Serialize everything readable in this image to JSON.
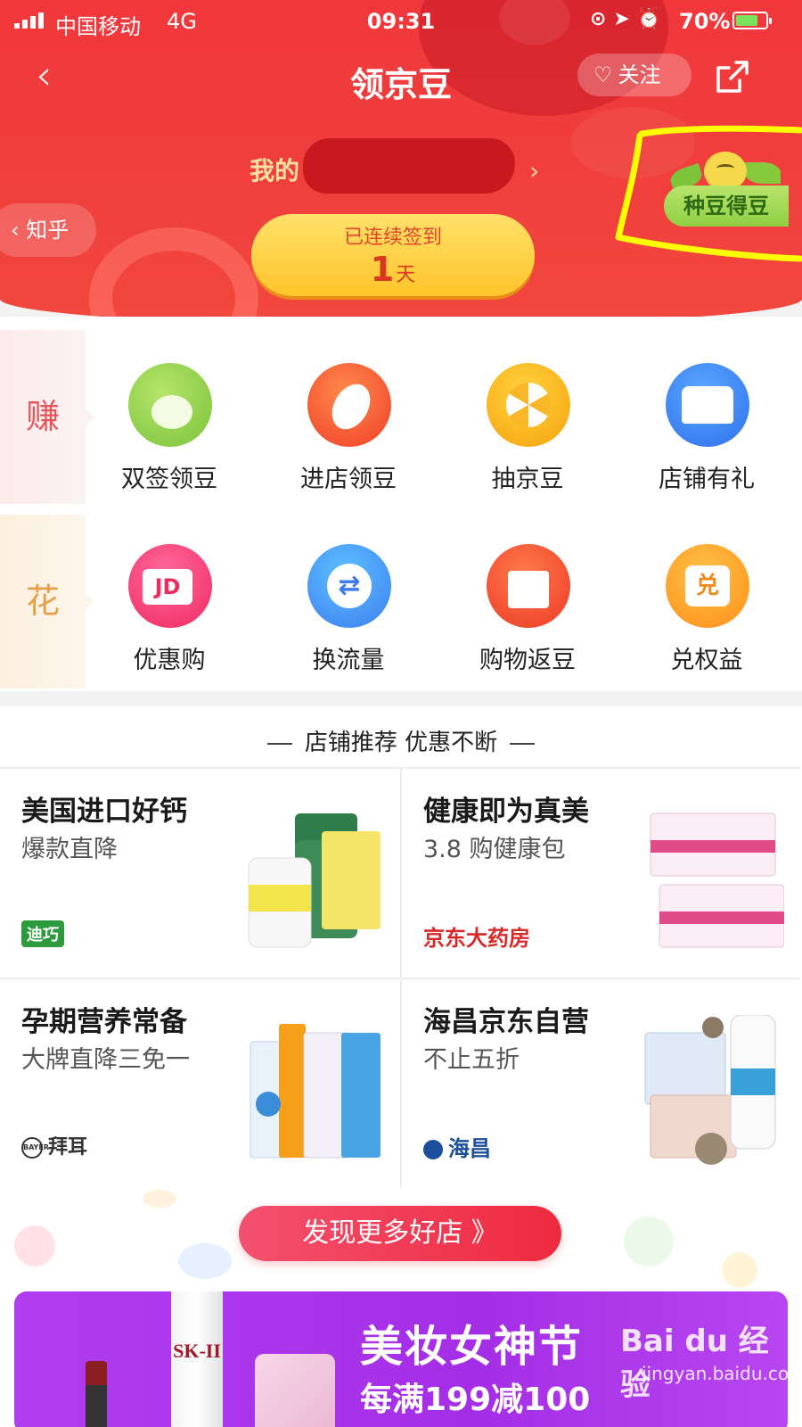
{
  "status_bar": {
    "carrier": "中国移动",
    "network": "4G",
    "time": "09:31",
    "battery": "70%"
  },
  "nav": {
    "title": "领京豆",
    "follow_label": "关注"
  },
  "header": {
    "my_beans_label": "我的",
    "zhihu_back_label": "知乎",
    "signin_label": "已连续签到",
    "signin_days": "1",
    "signin_unit": "天",
    "plant_badge": "种豆得豆"
  },
  "categories": {
    "earn_label": "赚",
    "spend_label": "花"
  },
  "earn_items": [
    {
      "label": "双签领豆",
      "icon": "bean-green-icon"
    },
    {
      "label": "进店领豆",
      "icon": "bean-orange-icon"
    },
    {
      "label": "抽京豆",
      "icon": "lottery-wheel-icon"
    },
    {
      "label": "店铺有礼",
      "icon": "store-icon"
    }
  ],
  "spend_items": [
    {
      "label": "优惠购",
      "icon": "jd-cart-icon"
    },
    {
      "label": "换流量",
      "icon": "exchange-arrows-icon"
    },
    {
      "label": "购物返豆",
      "icon": "gift-box-icon"
    },
    {
      "label": "兑权益",
      "icon": "redeem-icon"
    }
  ],
  "recommend": {
    "title": "店铺推荐 优惠不断",
    "cards": [
      {
        "title": "美国进口好钙",
        "subtitle": "爆款直降",
        "brand": "迪巧"
      },
      {
        "title": "健康即为真美",
        "subtitle": "3.8 购健康包",
        "brand": "京东大药房"
      },
      {
        "title": "孕期营养常备",
        "subtitle": "大牌直降三免一",
        "brand": "拜耳"
      },
      {
        "title": "海昌京东自营",
        "subtitle": "不止五折",
        "brand": "海昌"
      }
    ]
  },
  "more_stores_label": "发现更多好店 》",
  "banner": {
    "title": "美妆女神节",
    "subtitle": "每满199减100",
    "bottle_text": "SK-II",
    "watermark": "Bai du 经验",
    "watermark_url": "jingyan.baidu.com"
  },
  "colors": {
    "header_red": "#f1373c",
    "signin_yellow": "#ffc52b",
    "more_button": "#ee2a3f",
    "banner_purple": "#a42ee6",
    "highlight_yellow": "#ffff00"
  }
}
